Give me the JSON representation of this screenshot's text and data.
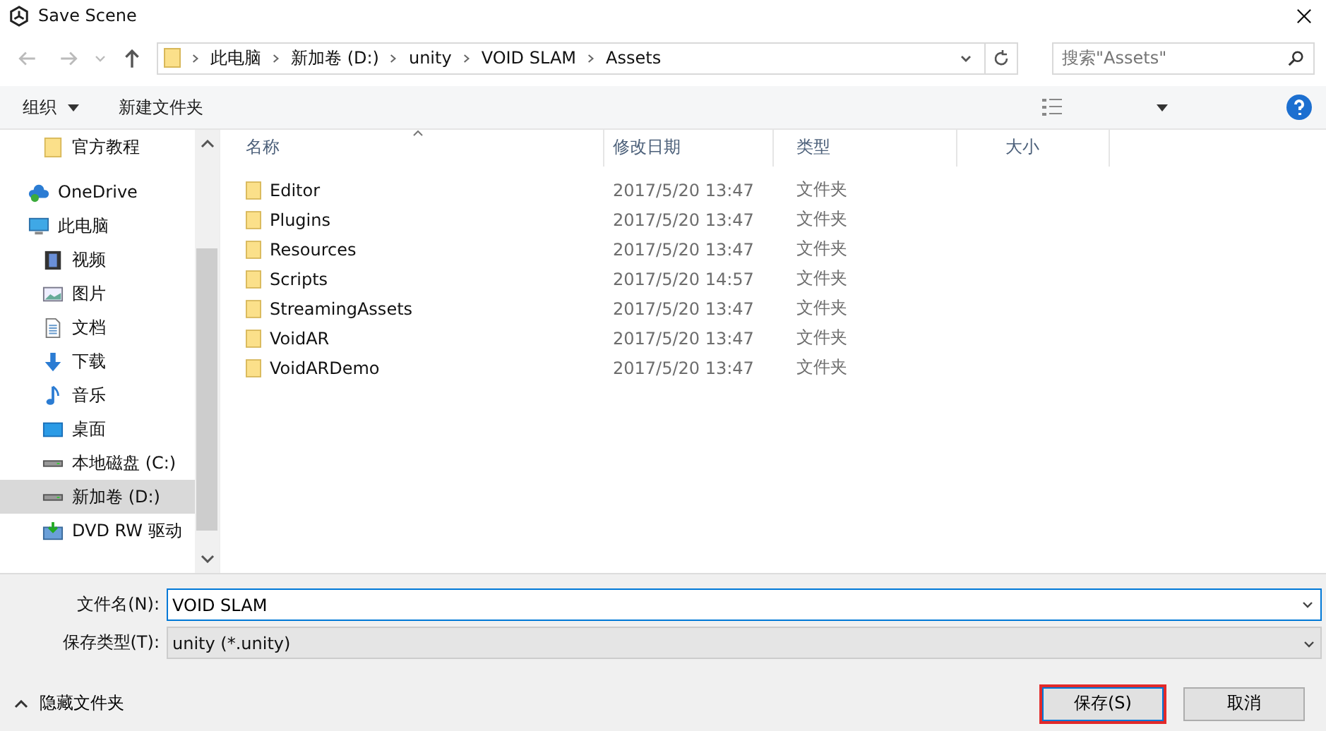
{
  "window": {
    "title": "Save Scene"
  },
  "address": {
    "crumbs": [
      "此电脑",
      "新加卷 (D:)",
      "unity",
      "VOID SLAM",
      "Assets"
    ],
    "search_placeholder": "搜索\"Assets\""
  },
  "toolbar": {
    "organize": "组织",
    "new_folder": "新建文件夹"
  },
  "sidebar": {
    "items": [
      {
        "label": "官方教程",
        "kind": "folder",
        "selected": false
      },
      {
        "label": "OneDrive",
        "kind": "cloud",
        "selected": false
      },
      {
        "label": "此电脑",
        "kind": "pc",
        "selected": false,
        "children": [
          {
            "label": "视频",
            "kind": "video",
            "selected": false
          },
          {
            "label": "图片",
            "kind": "image",
            "selected": false
          },
          {
            "label": "文档",
            "kind": "doc",
            "selected": false
          },
          {
            "label": "下载",
            "kind": "download",
            "selected": false
          },
          {
            "label": "音乐",
            "kind": "music",
            "selected": false
          },
          {
            "label": "桌面",
            "kind": "desktop",
            "selected": false
          },
          {
            "label": "本地磁盘 (C:)",
            "kind": "drive",
            "selected": false
          },
          {
            "label": "新加卷 (D:)",
            "kind": "drive",
            "selected": true
          },
          {
            "label": "DVD RW 驱动",
            "kind": "dvd",
            "selected": false
          }
        ]
      }
    ]
  },
  "table": {
    "columns": [
      "名称",
      "修改日期",
      "类型",
      "大小"
    ],
    "rows": [
      {
        "name": "Editor",
        "modified": "2017/5/20 13:47",
        "type": "文件夹"
      },
      {
        "name": "Plugins",
        "modified": "2017/5/20 13:47",
        "type": "文件夹"
      },
      {
        "name": "Resources",
        "modified": "2017/5/20 13:47",
        "type": "文件夹"
      },
      {
        "name": "Scripts",
        "modified": "2017/5/20 14:57",
        "type": "文件夹"
      },
      {
        "name": "StreamingAssets",
        "modified": "2017/5/20 13:47",
        "type": "文件夹"
      },
      {
        "name": "VoidAR",
        "modified": "2017/5/20 13:47",
        "type": "文件夹"
      },
      {
        "name": "VoidARDemo",
        "modified": "2017/5/20 13:47",
        "type": "文件夹"
      }
    ]
  },
  "form": {
    "filename_label": "文件名(N):",
    "filename": "VOID SLAM",
    "filetype_label": "保存类型(T):",
    "filetype": "unity (*.unity)"
  },
  "footer": {
    "hide_folders": "隐藏文件夹",
    "buttons": [
      {
        "label": "保存(S)",
        "highlighted": true
      },
      {
        "label": "取消",
        "highlighted": false
      }
    ]
  }
}
